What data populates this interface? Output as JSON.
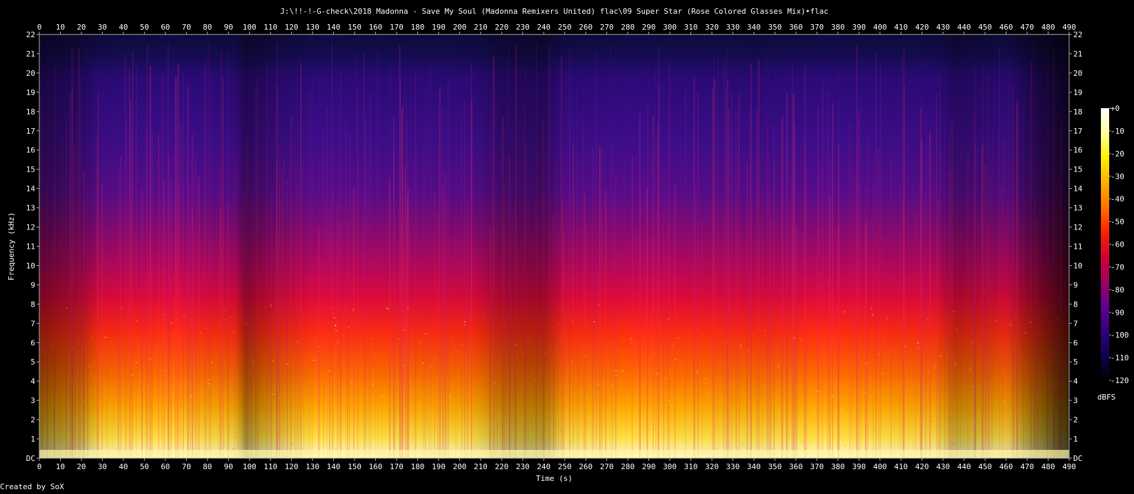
{
  "chart_data": {
    "type": "heatmap",
    "title": "J:\\!!-!-G-check\\2018 Madonna - Save My Soul (Madonna Remixers United) flac\\09 Super Star (Rose Colored Glasses Mix)•flac",
    "xlabel": "Time (s)",
    "ylabel": "Frequency (kHz)",
    "x_ticks": [
      "0",
      "10",
      "20",
      "30",
      "40",
      "50",
      "60",
      "70",
      "80",
      "90",
      "100",
      "110",
      "120",
      "130",
      "140",
      "150",
      "160",
      "170",
      "180",
      "190",
      "200",
      "210",
      "220",
      "230",
      "240",
      "250",
      "260",
      "270",
      "280",
      "290",
      "300",
      "310",
      "320",
      "330",
      "340",
      "350",
      "360",
      "370",
      "380",
      "390",
      "400",
      "410",
      "420",
      "430",
      "440",
      "450",
      "460",
      "470",
      "480",
      "490"
    ],
    "y_ticks": [
      "DC",
      "1",
      "2",
      "3",
      "4",
      "5",
      "6",
      "7",
      "8",
      "9",
      "10",
      "11",
      "12",
      "13",
      "14",
      "15",
      "16",
      "17",
      "18",
      "19",
      "20",
      "21",
      "22"
    ],
    "xlim": [
      0,
      490
    ],
    "ylim": [
      0,
      22
    ],
    "colorbar": {
      "label": "dBFS",
      "ticks": [
        "+0",
        "-10",
        "-20",
        "-30",
        "-40",
        "-50",
        "-60",
        "-70",
        "-80",
        "-90",
        "-100",
        "-110",
        "-120"
      ],
      "range": [
        -120,
        0
      ]
    },
    "footer": "Created by SoX",
    "colors": {
      "background": "#000000",
      "text": "#ffffff",
      "gradient": [
        "#ffffff",
        "#ffffa0",
        "#fff000",
        "#ffb000",
        "#ff7000",
        "#ff2000",
        "#d80030",
        "#a00060",
        "#600090",
        "#300080",
        "#100050",
        "#000000"
      ]
    }
  }
}
